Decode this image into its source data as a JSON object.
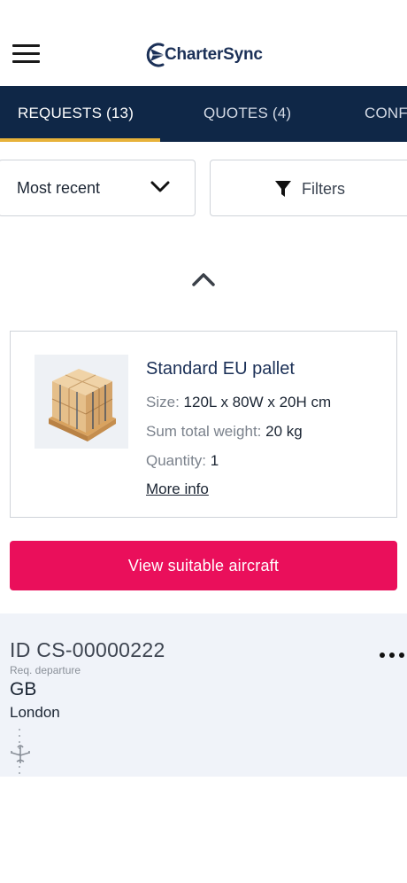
{
  "header": {
    "logo_text": "CharterSync",
    "brand_color": "#1b3057"
  },
  "tabs": [
    {
      "label": "REQUESTS (13)",
      "active": true
    },
    {
      "label": "QUOTES (4)",
      "active": false
    },
    {
      "label": "CONF",
      "active": false
    }
  ],
  "sort": {
    "selected": "Most recent"
  },
  "filters": {
    "label": "Filters"
  },
  "cargo": {
    "title": "Standard EU pallet",
    "size_label": "Size:",
    "size_value": "120L x 80W x 20H cm",
    "weight_label": "Sum total weight:",
    "weight_value": "20 kg",
    "quantity_label": "Quantity:",
    "quantity_value": "1",
    "more_info": "More info"
  },
  "cta": {
    "label": "View suitable aircraft",
    "color": "#ea0f5b"
  },
  "request": {
    "id": "ID CS-00000222",
    "departure_label": "Req. departure",
    "country": "GB",
    "city": "London"
  },
  "icons": {
    "menu": "hamburger-menu-icon",
    "sort": "chevron-down-icon",
    "filter": "funnel-icon",
    "collapse": "chevron-up-icon",
    "request_menu": "more-horizontal-icon",
    "flight": "airplane-icon"
  },
  "colors": {
    "tab_bar": "#0f2747",
    "tab_indicator": "#e7b23a",
    "request_bg": "#f0f3f9"
  }
}
